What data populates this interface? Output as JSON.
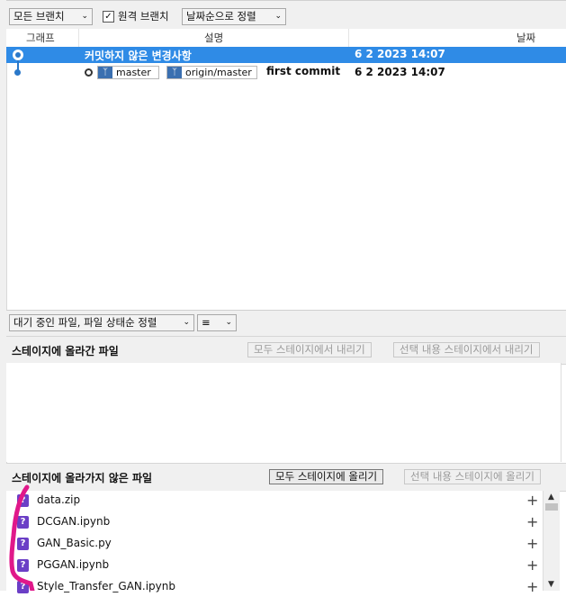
{
  "toolbar": {
    "branch_filter": "모든 브랜치",
    "remote_branches_label": "원격 브랜치",
    "remote_branches_checked": true,
    "sort_order": "날짜순으로 정렬"
  },
  "columns": {
    "graph": "그래프",
    "description": "설명",
    "date": "날짜"
  },
  "commits": [
    {
      "message": "커밋하지 않은 변경사항",
      "date": "6 2 2023 14:07",
      "selected": true
    },
    {
      "message": "first commit",
      "date": "6 2 2023 14:07",
      "refs": [
        "master",
        "origin/master"
      ]
    }
  ],
  "file_options": {
    "sort_mode": "대기 중인 파일, 파일 상태순 정렬",
    "view_icon": "list-icon"
  },
  "staged": {
    "title": "스테이지에 올라간 파일",
    "unstage_all": "모두 스테이지에서 내리기",
    "unstage_selected": "선택 내용 스테이지에서 내리기"
  },
  "unstaged": {
    "title": "스테이지에 올라가지 않은 파일",
    "stage_all": "모두 스테이지에 올리기",
    "stage_selected": "선택 내용 스테이지에 올리기",
    "files": [
      "data.zip",
      "DCGAN.ipynb",
      "GAN_Basic.py",
      "PGGAN.ipynb",
      "Style_Transfer_GAN.ipynb"
    ]
  },
  "colors": {
    "selection": "#2f8be6",
    "graph": "#2a78c9",
    "untracked_icon": "#6b3fc6",
    "annotation": "#e0188a"
  }
}
